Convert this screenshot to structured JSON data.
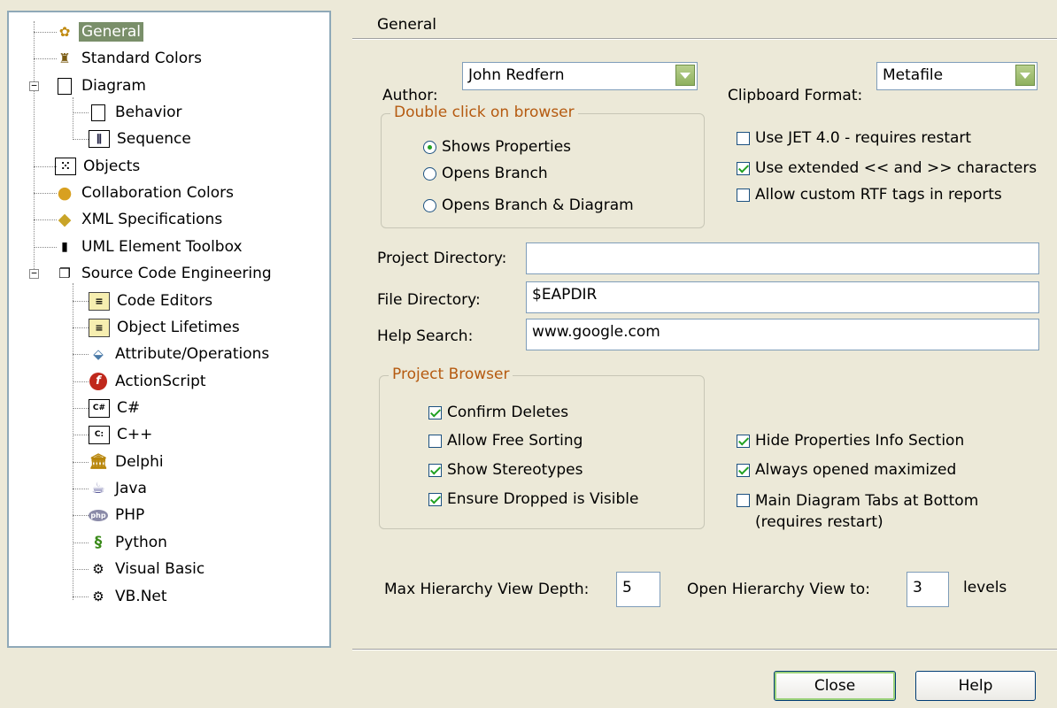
{
  "tree": {
    "items": [
      {
        "label": "General",
        "icon": "general-icon"
      },
      {
        "label": "Standard Colors",
        "icon": "paint-brushes-icon"
      },
      {
        "label": "Diagram",
        "icon": "document-icon"
      },
      {
        "label": "Behavior",
        "icon": "document-icon"
      },
      {
        "label": "Sequence",
        "icon": "sequence-icon"
      },
      {
        "label": "Objects",
        "icon": "objects-icon"
      },
      {
        "label": "Collaboration Colors",
        "icon": "palette-icon"
      },
      {
        "label": "XML Specifications",
        "icon": "xml-icon"
      },
      {
        "label": "UML Element Toolbox",
        "icon": "toolbox-icon"
      },
      {
        "label": "Source Code Engineering",
        "icon": "source-code-icon"
      },
      {
        "label": "Code Editors",
        "icon": "code-editor-icon"
      },
      {
        "label": "Object Lifetimes",
        "icon": "code-editor-icon"
      },
      {
        "label": "Attribute/Operations",
        "icon": "attribute-icon"
      },
      {
        "label": "ActionScript",
        "icon": "flash-icon"
      },
      {
        "label": "C#",
        "icon": "csharp-icon"
      },
      {
        "label": "C++",
        "icon": "cpp-icon"
      },
      {
        "label": "Delphi",
        "icon": "delphi-icon"
      },
      {
        "label": "Java",
        "icon": "java-icon"
      },
      {
        "label": "PHP",
        "icon": "php-icon"
      },
      {
        "label": "Python",
        "icon": "python-icon"
      },
      {
        "label": "Visual Basic",
        "icon": "vb-icon"
      },
      {
        "label": "VB.Net",
        "icon": "vbnet-icon"
      }
    ],
    "selected": "General"
  },
  "panel": {
    "title": "General",
    "author_label": "Author:",
    "author_value": "John Redfern",
    "clipboard_label": "Clipboard Format:",
    "clipboard_value": "Metafile",
    "dblclick": {
      "title": "Double click on browser",
      "options": [
        "Shows Properties",
        "Opens Branch",
        "Opens Branch  & Diagram"
      ],
      "selected": "Shows Properties"
    },
    "right_checks": [
      {
        "label": "Use JET 4.0 - requires restart",
        "checked": false
      },
      {
        "label": "Use extended << and >> characters",
        "checked": true
      },
      {
        "label": "Allow custom RTF tags in reports",
        "checked": false
      }
    ],
    "project_dir_label": "Project Directory:",
    "project_dir_value": "",
    "file_dir_label": "File Directory:",
    "file_dir_value": "$EAPDIR",
    "help_search_label": "Help Search:",
    "help_search_value": "www.google.com",
    "project_browser": {
      "title": "Project Browser",
      "checks": [
        {
          "label": "Confirm Deletes",
          "checked": true
        },
        {
          "label": "Allow Free Sorting",
          "checked": false
        },
        {
          "label": "Show Stereotypes",
          "checked": true
        },
        {
          "label": "Ensure Dropped is Visible",
          "checked": true
        }
      ]
    },
    "extra_checks": [
      {
        "label": "Hide Properties Info Section",
        "checked": true
      },
      {
        "label": "Always opened maximized",
        "checked": true
      },
      {
        "label": "Main Diagram Tabs at Bottom",
        "label2": "(requires restart)",
        "checked": false
      }
    ],
    "max_depth_label": "Max Hierarchy View Depth:",
    "max_depth_value": "5",
    "open_to_label": "Open Hierarchy View to:",
    "open_to_value": "3",
    "levels_label": "levels"
  },
  "buttons": {
    "close": "Close",
    "help": "Help"
  },
  "colors": {
    "selection": "#7a8f6a",
    "group_title": "#b55a10",
    "check": "#21a121"
  }
}
